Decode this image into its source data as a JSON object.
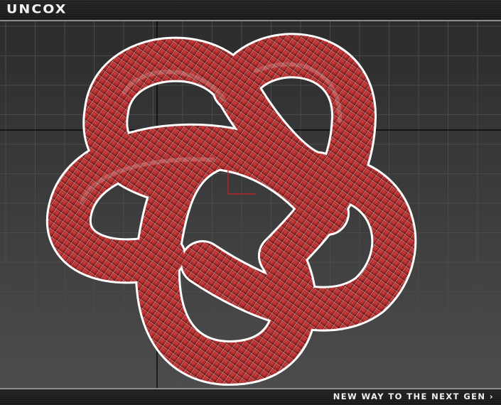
{
  "header": {
    "logo_text": "UNCOX"
  },
  "footer": {
    "tagline": "NEW WAY TO THE NEXT GEN ›"
  },
  "viewport": {
    "grid_color": "#4a4a4a",
    "axis_color": "#000000",
    "gizmo_color": "#cc2020",
    "knot_color": "#b02a2a",
    "wire_color": "#ffffff"
  }
}
